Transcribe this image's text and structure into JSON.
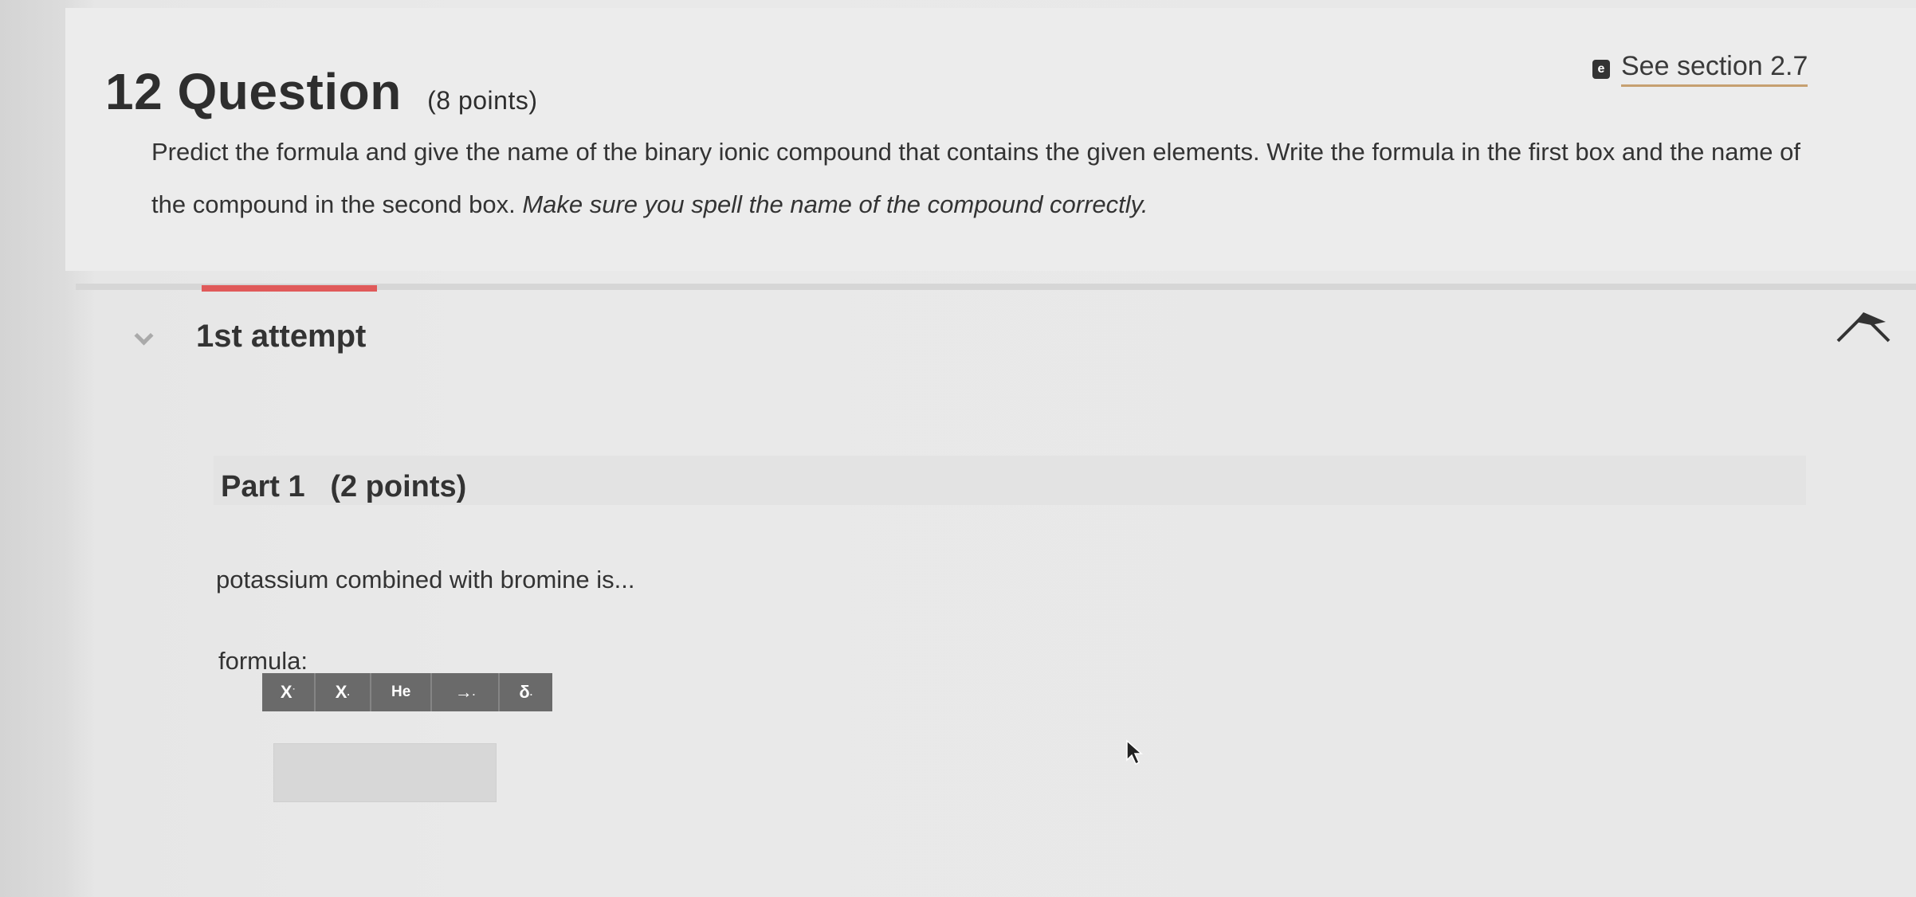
{
  "question": {
    "number": "12",
    "title": "Question",
    "points": "(8 points)"
  },
  "section_link": {
    "icon": "ebook-icon",
    "icon_letter": "e",
    "label": "See section 2.7"
  },
  "prompt": {
    "text": "Predict the formula and give the name of the binary ionic compound that contains the given elements. Write the formula in the first box and the name of the compound in the second box. ",
    "emphasis": "Make sure you spell the name of the compound correctly."
  },
  "attempt": {
    "label": "1st attempt"
  },
  "part": {
    "title": "Part 1",
    "points": "(2 points)",
    "prompt": "potassium combined with bromine is...",
    "formula_label": "formula:"
  },
  "toolbar": {
    "superscript": "X",
    "subscript": "X",
    "element": "He",
    "arrow": "→",
    "delta": "δ"
  },
  "colors": {
    "tab_accent": "#e05a5a",
    "link_underline": "#c6a070",
    "toolbar_bg": "#6a6a6a"
  }
}
